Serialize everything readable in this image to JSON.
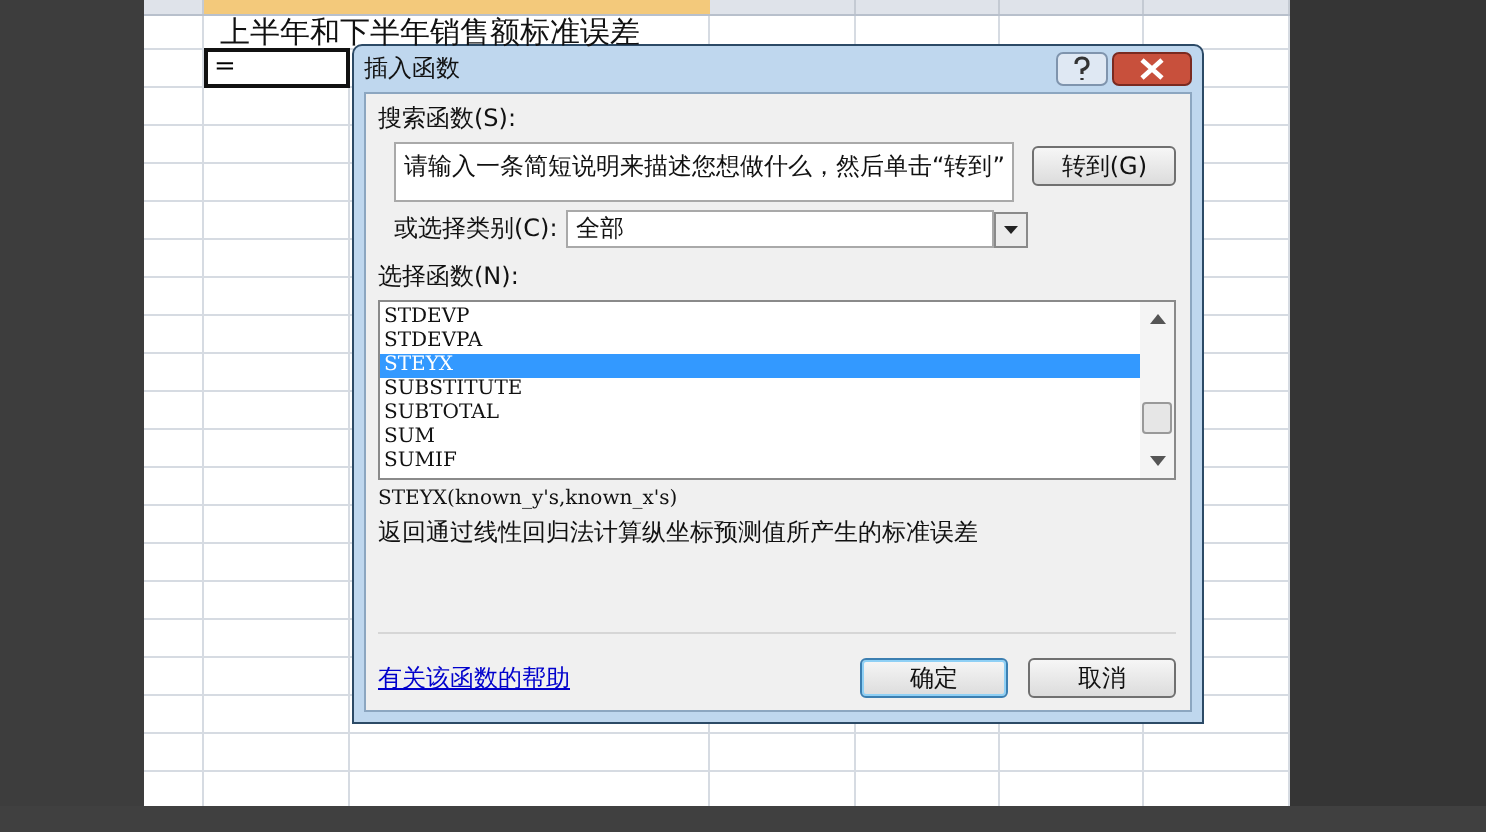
{
  "sheet": {
    "title_cell": "上半年和下半年销售额标准误差",
    "active_cell": "="
  },
  "dialog": {
    "title": "插入函数",
    "search_label": "搜索函数(S):",
    "search_value": "请输入一条简短说明来描述您想做什么，然后单击“转到”",
    "go_button": "转到(G)",
    "category_label": "或选择类别(C):",
    "category_value": "全部",
    "function_label": "选择函数(N):",
    "functions": [
      {
        "name": "STDEVP",
        "selected": false
      },
      {
        "name": "STDEVPA",
        "selected": false
      },
      {
        "name": "STEYX",
        "selected": true
      },
      {
        "name": "SUBSTITUTE",
        "selected": false
      },
      {
        "name": "SUBTOTAL",
        "selected": false
      },
      {
        "name": "SUM",
        "selected": false
      },
      {
        "name": "SUMIF",
        "selected": false
      }
    ],
    "syntax": "STEYX(known_y's,known_x's)",
    "description": "返回通过线性回归法计算纵坐标预测值所产生的标准误差",
    "help_link": "有关该函数的帮助",
    "buttons": [
      "确定",
      "取消"
    ]
  }
}
